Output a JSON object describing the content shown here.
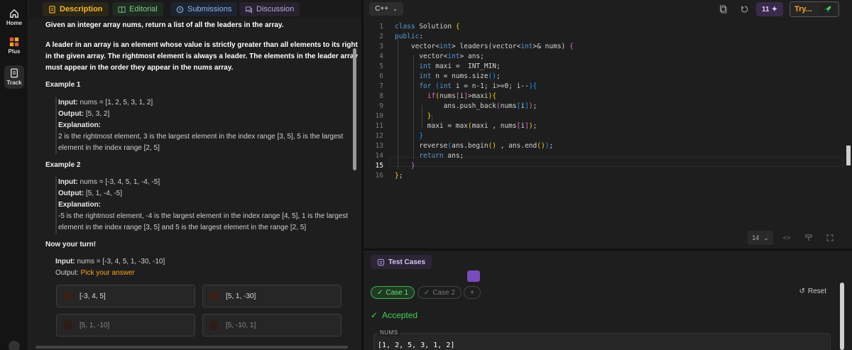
{
  "rail": {
    "home": "Home",
    "plus": "Plus",
    "track": "Track"
  },
  "tabs": {
    "description": "Description",
    "editorial": "Editorial",
    "submissions": "Submissions",
    "discussion": "Discussion"
  },
  "problem": {
    "line1_a": "Given an integer array ",
    "line1_b": "nums",
    "line1_c": ", return a list of all the leaders in the array.",
    "p2_a": "A leader in an array is an element whose value is ",
    "p2_b": "strictly",
    "p2_c": " greater than all elements to its right in the given array. The rightmost element is always a leader. The elements in the leader array must appear in the ",
    "p2_d": "order they appear",
    "p2_e": " in the nums array."
  },
  "example1": {
    "title": "Example 1",
    "input_label": "Input:",
    "input": " nums = [1, 2, 5, 3, 1, 2]",
    "output_label": "Output:",
    "output": " [5, 3, 2]",
    "explanation_label": "Explanation:",
    "explanation": "2 is the rightmost element, 3 is the largest element in the index range [3, 5], 5 is the largest element in the index range [2, 5]"
  },
  "example2": {
    "title": "Example 2",
    "input_label": "Input:",
    "input": " nums = [-3, 4, 5, 1, -4, -5]",
    "output_label": "Output:",
    "output": " [5, 1, -4, -5]",
    "explanation_label": "Explanation:",
    "explanation": "-5 is the rightmost element, -4 is the largest element in the index range [4, 5], 1 is the largest element in the index range [3, 5] and 5 is the largest element in the range [2, 5]"
  },
  "turn": {
    "title": "Now your turn!",
    "input_label": "Input:",
    "input": " nums = [-3, 4, 5, 1, -30, -10]",
    "output_label": "Output:",
    "pick": "Pick your answer",
    "options": [
      "[-3, 4, 5]",
      "[5, 1, -30]",
      "[5, 1, -10]",
      "[5, -10, 1]"
    ]
  },
  "editor_bar": {
    "language": "C++",
    "streak": "11",
    "try": "Try..."
  },
  "code": {
    "line_numbers": [
      "1",
      "2",
      "3",
      "4",
      "5",
      "6",
      "7",
      "8",
      "9",
      "10",
      "11",
      "12",
      "13",
      "14",
      "15",
      "16"
    ],
    "current_line": "15"
  },
  "editor_footer": {
    "font_size": "14"
  },
  "testcases": {
    "tab": "Test Cases",
    "case1": "Case 1",
    "case2": "Case 2",
    "add": "+",
    "reset": "Reset",
    "status": "Accepted",
    "nums_label": "NUMS",
    "nums_value": "[1, 2, 5, 3, 1, 2]"
  },
  "colors": {
    "accent_orange": "#f5a623",
    "accepted_green": "#3fd05a",
    "editor_bg": "#1e1e1e"
  }
}
